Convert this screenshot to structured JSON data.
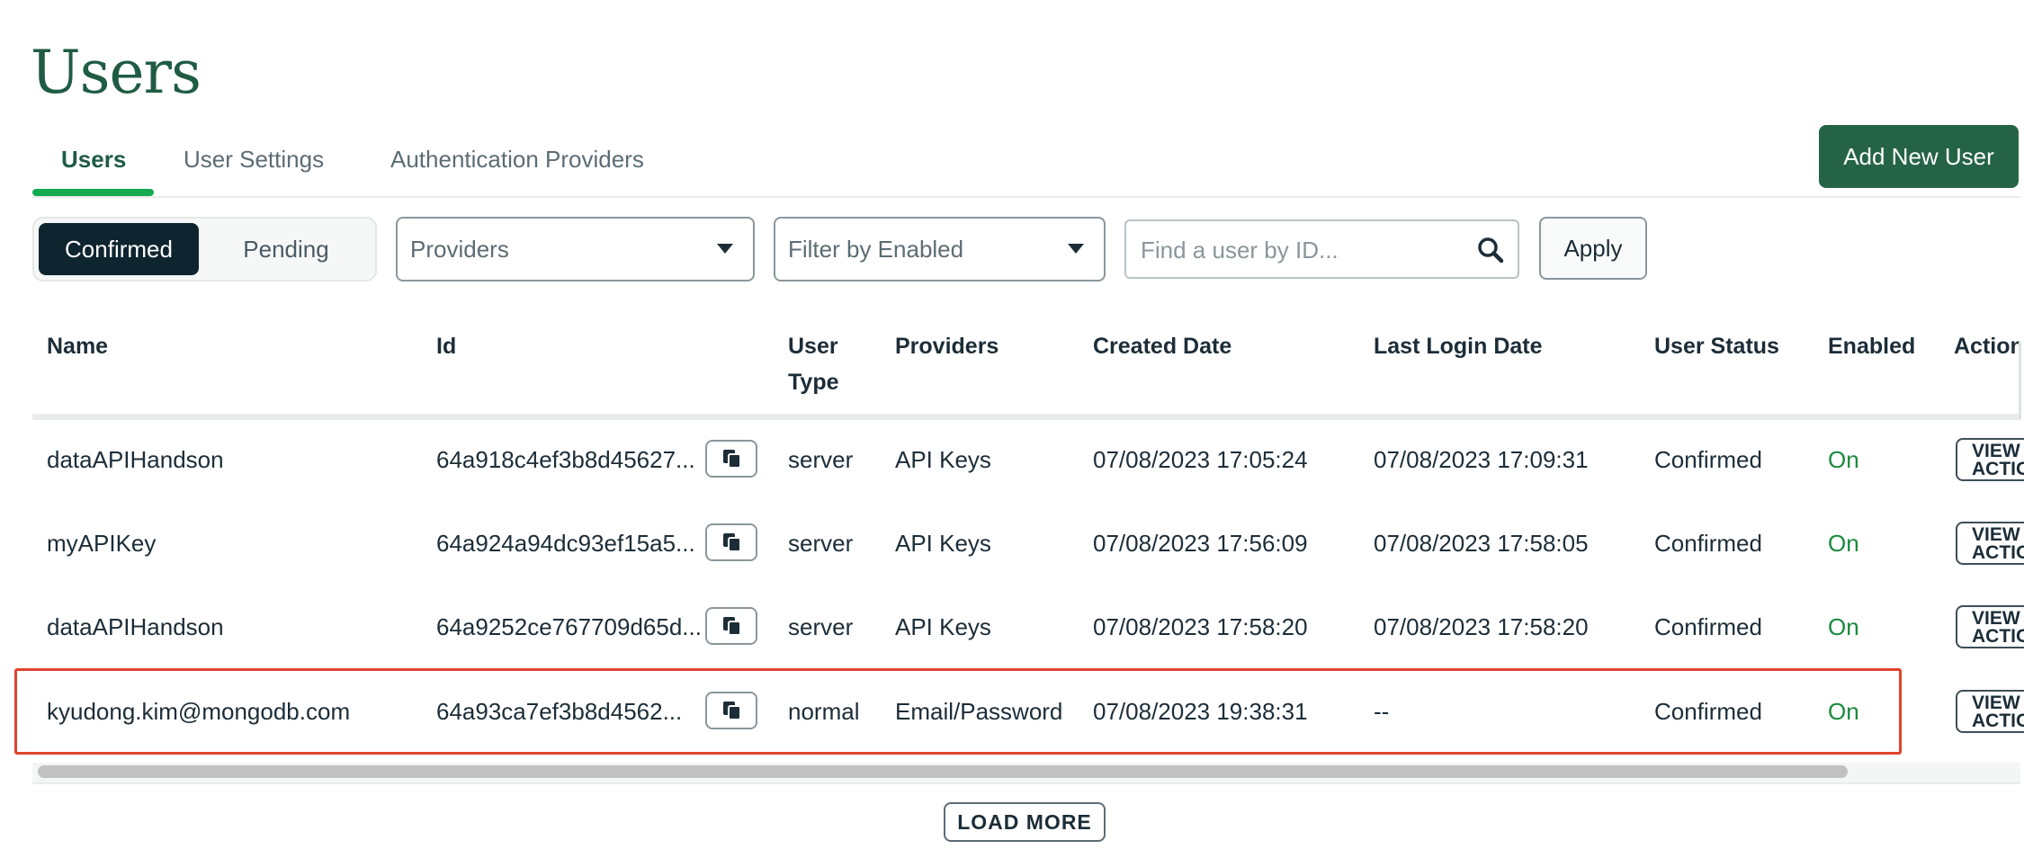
{
  "page": {
    "title": "Users"
  },
  "tabs": [
    {
      "label": "Users",
      "active": true
    },
    {
      "label": "User Settings",
      "active": false
    },
    {
      "label": "Authentication Providers",
      "active": false
    }
  ],
  "add_button": "Add New User",
  "filters": {
    "segment": {
      "options": [
        "Confirmed",
        "Pending"
      ],
      "selected": "Confirmed"
    },
    "providers_select": "Providers",
    "enabled_select": "Filter by Enabled",
    "search_placeholder": "Find a user by ID...",
    "search_value": "",
    "apply_label": "Apply"
  },
  "table": {
    "columns": {
      "name": "Name",
      "id": "Id",
      "user_type_line1": "User",
      "user_type_line2": "Type",
      "providers": "Providers",
      "created": "Created Date",
      "last_login": "Last Login Date",
      "status": "User Status",
      "enabled": "Enabled",
      "actions": "Actions"
    },
    "rows": [
      {
        "name": "dataAPIHandson",
        "id": "64a918c4ef3b8d45627...",
        "type": "server",
        "providers": "API Keys",
        "created": "07/08/2023 17:05:24",
        "last_login": "07/08/2023 17:09:31",
        "status": "Confirmed",
        "enabled": "On",
        "action_line1": "VIEW",
        "action_line2": "ACTIONS"
      },
      {
        "name": "myAPIKey",
        "id": "64a924a94dc93ef15a5...",
        "type": "server",
        "providers": "API Keys",
        "created": "07/08/2023 17:56:09",
        "last_login": "07/08/2023 17:58:05",
        "status": "Confirmed",
        "enabled": "On",
        "action_line1": "VIEW",
        "action_line2": "ACTIONS"
      },
      {
        "name": "dataAPIHandson",
        "id": "64a9252ce767709d65d...",
        "type": "server",
        "providers": "API Keys",
        "created": "07/08/2023 17:58:20",
        "last_login": "07/08/2023 17:58:20",
        "status": "Confirmed",
        "enabled": "On",
        "action_line1": "VIEW",
        "action_line2": "ACTIONS"
      },
      {
        "name": "kyudong.kim@mongodb.com",
        "id": "64a93ca7ef3b8d4562...",
        "type": "normal",
        "providers": "Email/Password",
        "created": "07/08/2023 19:38:31",
        "last_login": "--",
        "status": "Confirmed",
        "enabled": "On",
        "action_line1": "VIEW",
        "action_line2": "ACTIONS"
      }
    ]
  },
  "load_more": "LOAD MORE",
  "colors": {
    "brand_green": "#256346",
    "title_green": "#1f5c43",
    "tab_underline": "#13aa52",
    "highlight_red": "#e0432f",
    "enabled_green": "#1a8a3f"
  },
  "icons": {
    "search": "magnifier-icon",
    "copy": "copy-icon",
    "dropdown": "caret-down-icon"
  }
}
